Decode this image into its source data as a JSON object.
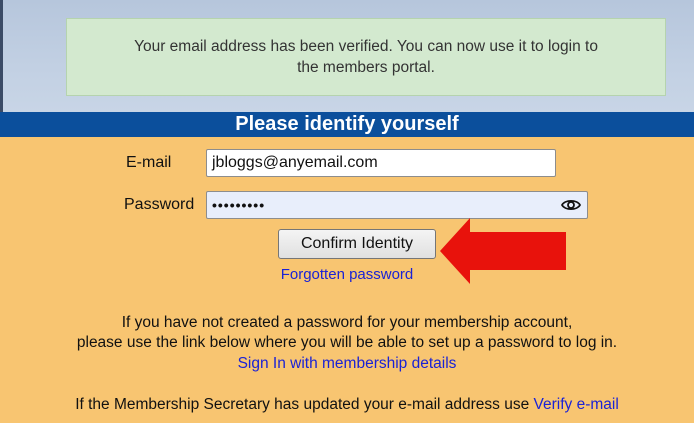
{
  "notice": {
    "line1": "Your email address has been verified. You can now use it to login to",
    "line2": "the members portal."
  },
  "header": {
    "title": "Please identify yourself"
  },
  "form": {
    "email_label": "E-mail",
    "email_value": "jbloggs@anyemail.com",
    "password_label": "Password",
    "password_value": "•••••••••",
    "confirm_label": "Confirm Identity",
    "forgot_label": "Forgotten password"
  },
  "info": {
    "line1": "If you have not created a password for your membership account,",
    "line2": "please use the link below where you will be able to set up a password to log in.",
    "signin_link": "Sign In with membership details",
    "secretary_text": "If the Membership Secretary has updated your e-mail address use ",
    "verify_link": "Verify e-mail"
  },
  "icons": {
    "reveal": "eye-icon",
    "pointer": "red-arrow-icon"
  },
  "colors": {
    "header_bg": "#0b4f9c",
    "panel_bg": "#f8c571",
    "link": "#1a22d6",
    "notice_bg": "#d3e9cf",
    "arrow": "#e8120c"
  }
}
